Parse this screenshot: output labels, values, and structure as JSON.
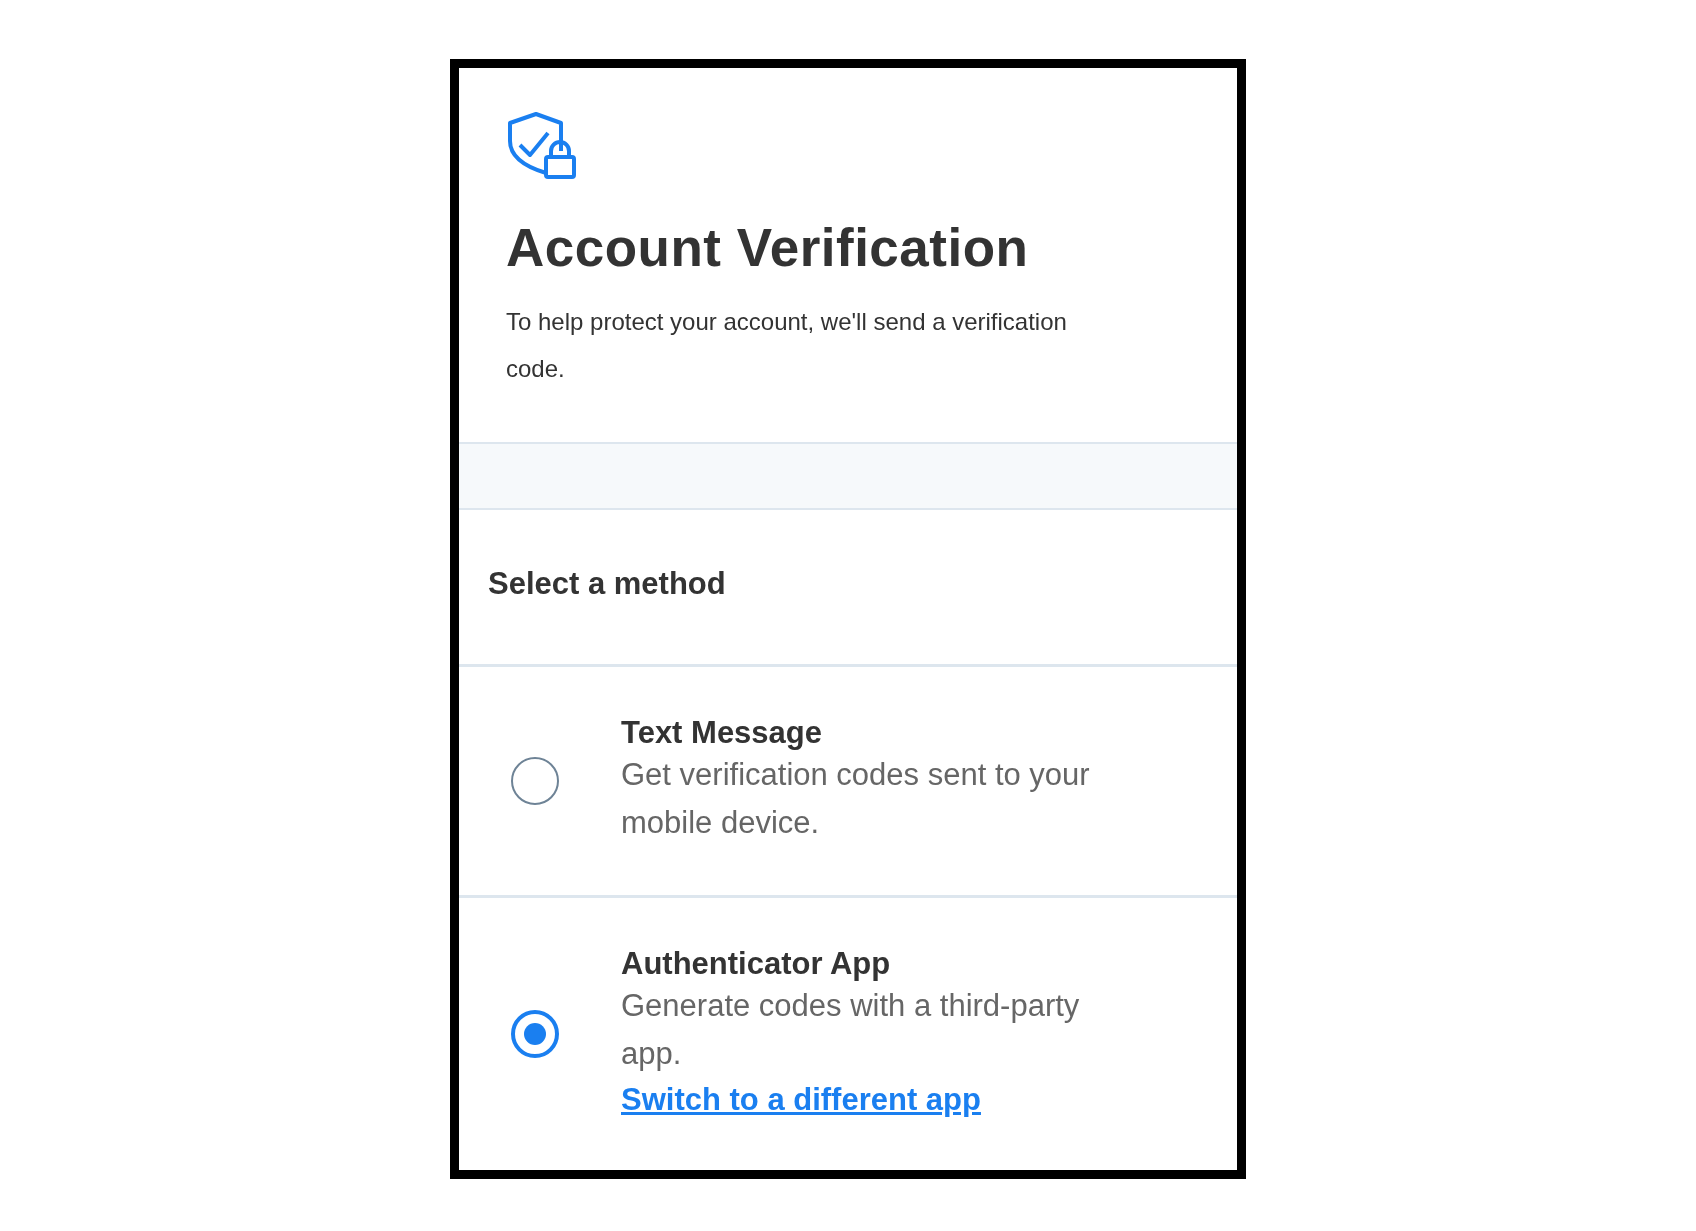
{
  "header": {
    "title": "Account Verification",
    "description": "To help protect your account, we'll send a verification code."
  },
  "methods_heading": "Select a method",
  "methods": [
    {
      "title": "Text Message",
      "description": "Get verification codes sent to your mobile device.",
      "selected": false
    },
    {
      "title": "Authenticator App",
      "description": "Generate codes with a third-party app.",
      "selected": true,
      "link": "Switch to a different app"
    }
  ]
}
